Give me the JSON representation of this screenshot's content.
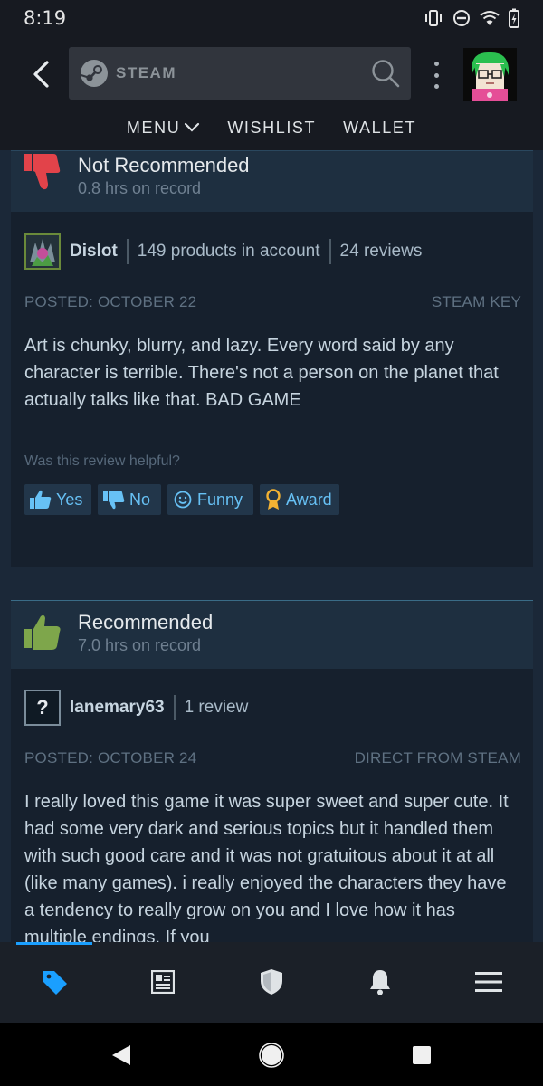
{
  "status_bar": {
    "time": "8:19"
  },
  "header": {
    "search_brand": "STEAM",
    "nav": {
      "menu": "MENU",
      "wishlist": "WISHLIST",
      "wallet": "WALLET"
    }
  },
  "reviews": [
    {
      "verdict": "Not Recommended",
      "hours": "0.8 hrs on record",
      "author": "Dislot",
      "products": "149 products in account",
      "review_count": "24 reviews",
      "posted": "POSTED: OCTOBER 22",
      "source": "STEAM KEY",
      "body": "Art is chunky, blurry, and lazy. Every word said by any character is terrible. There's not a person on the planet that actually talks like that. BAD GAME",
      "helpful_question": "Was this review helpful?",
      "buttons": {
        "yes": "Yes",
        "no": "No",
        "funny": "Funny",
        "award": "Award"
      }
    },
    {
      "verdict": "Recommended",
      "hours": "7.0 hrs on record",
      "author": "lanemary63",
      "avatar_placeholder": "?",
      "review_count": "1 review",
      "posted": "POSTED: OCTOBER 24",
      "source": "DIRECT FROM STEAM",
      "body": "I really loved this game it was super sweet and super cute. It had some very dark and serious topics but it handled them with such good care and it was not gratuitous about it at all (like many games). i really enjoyed the characters they have a tendency to really grow on you and I love how it has multiple endings. If you"
    }
  ],
  "bottom_tabs": [
    "store-tag-icon",
    "news-icon",
    "shield-icon",
    "bell-icon",
    "menu-icon"
  ],
  "colors": {
    "accent": "#1a9fff",
    "link": "#67c1f5",
    "negative": "#e2434a",
    "positive": "#7ea64b",
    "background": "#1b2838"
  }
}
